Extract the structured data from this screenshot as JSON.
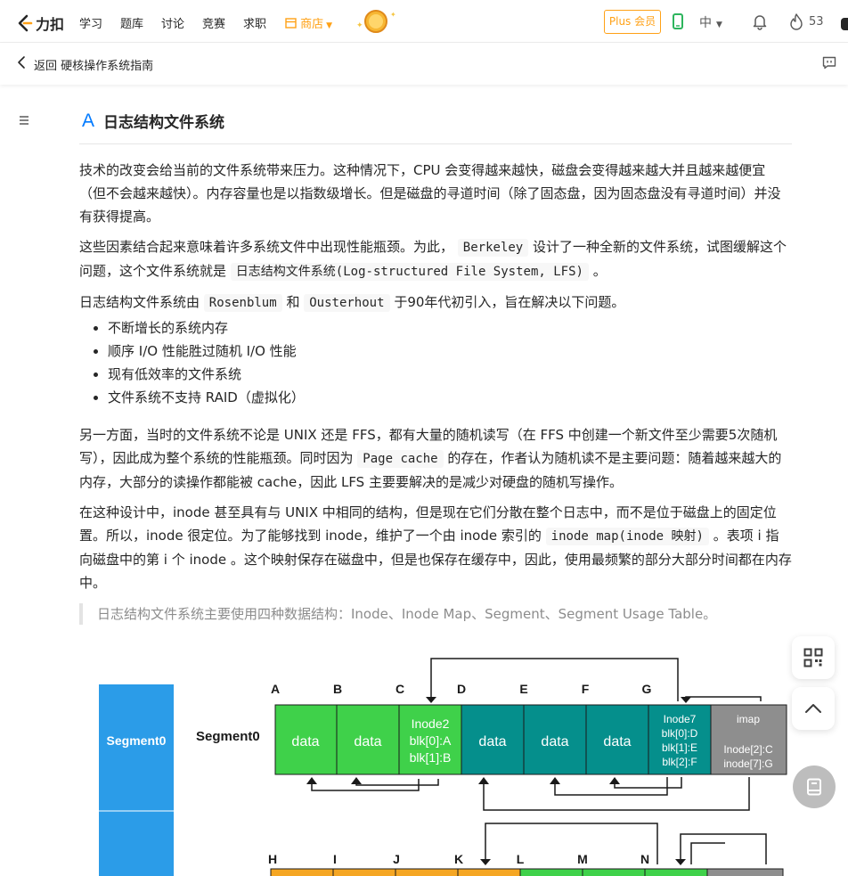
{
  "nav": {
    "logo_text": "力扣",
    "items": [
      "学习",
      "题库",
      "讨论",
      "竞赛",
      "求职"
    ],
    "shop_label": "商店",
    "plus_label": "Plus 会员",
    "lang_label": "中",
    "fire_count": "53",
    "accent_color": "#ffa116"
  },
  "subheader": {
    "back_label": "返回",
    "book_title": "硬核操作系统指南"
  },
  "article": {
    "heading_mark": "A",
    "title": "日志结构文件系统",
    "p1": "技术的改变会给当前的文件系统带来压力。这种情况下，CPU 会变得越来越快，磁盘会变得越来越大并且越来越便宜（但不会越来越快）。内存容量也是以指数级增长。但是磁盘的寻道时间（除了固态盘，因为固态盘没有寻道时间）并没有获得提高。",
    "p2": {
      "t1": "这些因素结合起来意味着许多系统文件中出现性能瓶颈。为此，",
      "c1": "Berkeley",
      "t2": "设计了一种全新的文件系统，试图缓解这个问题，这个文件系统就是",
      "c2": "日志结构文件系统(Log-structured File System, LFS)",
      "t3": "。"
    },
    "p3": {
      "t1": "日志结构文件系统由",
      "c1": "Rosenblum",
      "t2": "和",
      "c2": "Ousterhout",
      "t3": "于90年代初引入，旨在解决以下问题。"
    },
    "bullets": [
      "不断增长的系统内存",
      "顺序 I/O 性能胜过随机 I/O 性能",
      "现有低效率的文件系统",
      "文件系统不支持 RAID（虚拟化）"
    ],
    "p4": {
      "t1": "另一方面，当时的文件系统不论是 UNIX 还是 FFS，都有大量的随机读写（在 FFS 中创建一个新文件至少需要5次随机写），因此成为整个系统的性能瓶颈。同时因为",
      "c1": "Page cache",
      "t2": "的存在，作者认为随机读不是主要问题：随着越来越大的内存，大部分的读操作都能被 cache，因此 LFS 主要要解决的是减少对硬盘的随机写操作。"
    },
    "p5": {
      "t1": "在这种设计中，inode 甚至具有与 UNIX 中相同的结构，但是现在它们分散在整个日志中，而不是位于磁盘上的固定位置。所以，inode 很定位。为了能够找到 inode，维护了一个由 inode 索引的",
      "c1": "inode map(inode 映射)",
      "t2": "。表项 i 指向磁盘中的第 i 个 inode 。这个映射保存在磁盘中，但是也保存在缓存中，因此，使用最频繁的部分大部分时间都在内存中。"
    },
    "quote": "日志结构文件系统主要使用四种数据结构：Inode、Inode Map、Segment、Segment Usage Table。"
  },
  "diagram": {
    "segment_label": "Segment0",
    "row_label": "Segment0",
    "letters_top": [
      "A",
      "B",
      "C",
      "D",
      "E",
      "F",
      "G"
    ],
    "letters_bottom": [
      "H",
      "I",
      "J",
      "K",
      "L",
      "M",
      "N"
    ],
    "cells": [
      "data",
      "data",
      "data",
      "data",
      "data"
    ],
    "inode2": [
      "Inode2",
      "blk[0]:A",
      "blk[1]:B"
    ],
    "inode7": [
      "Inode7",
      "blk[0]:D",
      "blk[1]:E",
      "blk[2]:F"
    ],
    "imap": [
      "imap",
      "Inode[2]:C",
      "inode[7]:G"
    ],
    "colors": {
      "segment_blue": "#2b9ce8",
      "data_green": "#3fd14a",
      "data_teal": "#058f8c",
      "imap_gray": "#8e8e8e",
      "orange": "#f5a623"
    }
  }
}
